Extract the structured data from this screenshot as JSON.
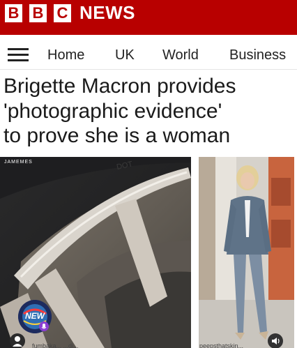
{
  "brand": {
    "letters": [
      "B",
      "B",
      "C"
    ],
    "word": "NEWS",
    "bar_color": "#b80000"
  },
  "nav": {
    "menu_icon": "hamburger-menu-icon",
    "items": [
      "Home",
      "UK",
      "World",
      "Business"
    ]
  },
  "article": {
    "headline_lines": [
      "Brigette Macron provides",
      "'photographic evidence'",
      "to prove she is a woman"
    ]
  },
  "images": {
    "left_watermark": "JAMEMES",
    "badge_text": "NEW",
    "left_caption": "fumbaka... ...di...",
    "right_caption": "peepsthatskin..."
  },
  "colors": {
    "brand_red": "#b80000",
    "text": "#1a1a1a"
  }
}
